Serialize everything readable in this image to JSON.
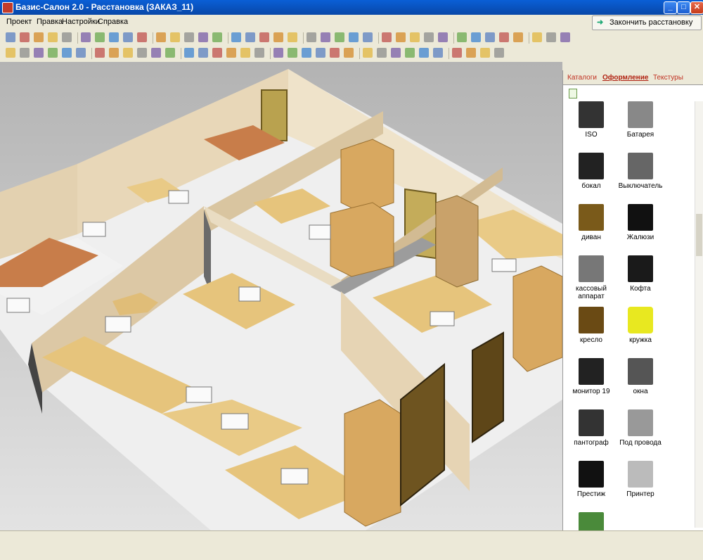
{
  "window": {
    "title": "Базис-Салон 2.0 -  Расстановка (ЗАКАЗ_11)"
  },
  "menu": [
    "Проект",
    "Правка",
    "Настройки",
    "Справка"
  ],
  "finish_button": "Закончить расстановку",
  "side_panel": {
    "tabs": [
      "Каталоги",
      "Оформление",
      "Текстуры"
    ],
    "active_tab": "Оформление",
    "items": [
      {
        "label": "ISO",
        "icon": "chair-icon"
      },
      {
        "label": "Батарея",
        "icon": "radiator-icon"
      },
      {
        "label": "бокал",
        "icon": "wineglass-icon"
      },
      {
        "label": "Выключатель",
        "icon": "switch-icon"
      },
      {
        "label": "диван",
        "icon": "sofa-icon"
      },
      {
        "label": "Жалюзи",
        "icon": "blinds-icon"
      },
      {
        "label": "кассовый аппарат",
        "icon": "cash-register-icon"
      },
      {
        "label": "Кофта",
        "icon": "sweater-icon"
      },
      {
        "label": "кресло",
        "icon": "armchair-icon"
      },
      {
        "label": "кружка",
        "icon": "mug-icon"
      },
      {
        "label": "монитор 19",
        "icon": "monitor-icon"
      },
      {
        "label": "окна",
        "icon": "windows-icon"
      },
      {
        "label": "пантограф",
        "icon": "pantograph-icon"
      },
      {
        "label": "Под провода",
        "icon": "cable-tray-icon"
      },
      {
        "label": "Престиж",
        "icon": "office-chair-icon"
      },
      {
        "label": "Принтер",
        "icon": "printer-icon"
      },
      {
        "label": "",
        "icon": "plant-icon"
      }
    ]
  },
  "colors": {
    "wood": "#e6c47c",
    "wall": "#e9d9bd",
    "floor": "#f0f0f0",
    "accent": "#c03020"
  }
}
